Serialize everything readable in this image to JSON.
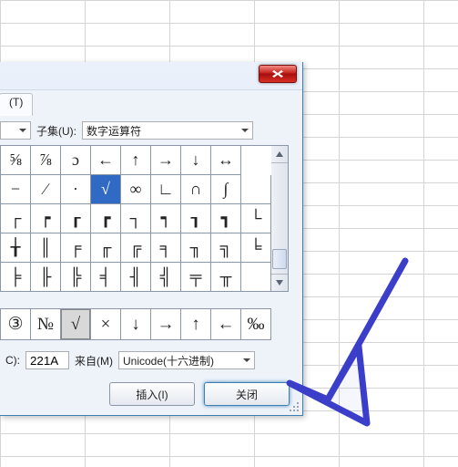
{
  "dialog": {
    "tab_label": "(T)",
    "subset_label": "子集(U):",
    "subset_value": "数字运算符",
    "code_label": "C):",
    "code_value": "221A",
    "from_label": "来自(M)",
    "from_value": "Unicode(十六进制)",
    "insert_label": "插入(I)",
    "close_label": "关闭"
  },
  "grid": [
    [
      "⅝",
      "⅞",
      "ɔ",
      "←",
      "↑",
      "→",
      "↓",
      "↔"
    ],
    [
      "−",
      "∕",
      "∙",
      "√",
      "∞",
      "∟",
      "∩",
      "∫"
    ],
    [
      "┌",
      "┍",
      "┎",
      "┏",
      "┐",
      "┑",
      "┒",
      "┓",
      "└"
    ],
    [
      "╁",
      "║",
      "╒",
      "╓",
      "╔",
      "╕",
      "╖",
      "╗",
      "╘"
    ],
    [
      "╞",
      "╟",
      "╠",
      "╡",
      "╢",
      "╣",
      "╤",
      "╥"
    ]
  ],
  "grid_selected": {
    "row": 1,
    "col": 3
  },
  "recent": [
    "③",
    "№",
    "√",
    "×",
    "↓",
    "→",
    "↑",
    "←",
    "‰"
  ],
  "recent_selected": 2
}
